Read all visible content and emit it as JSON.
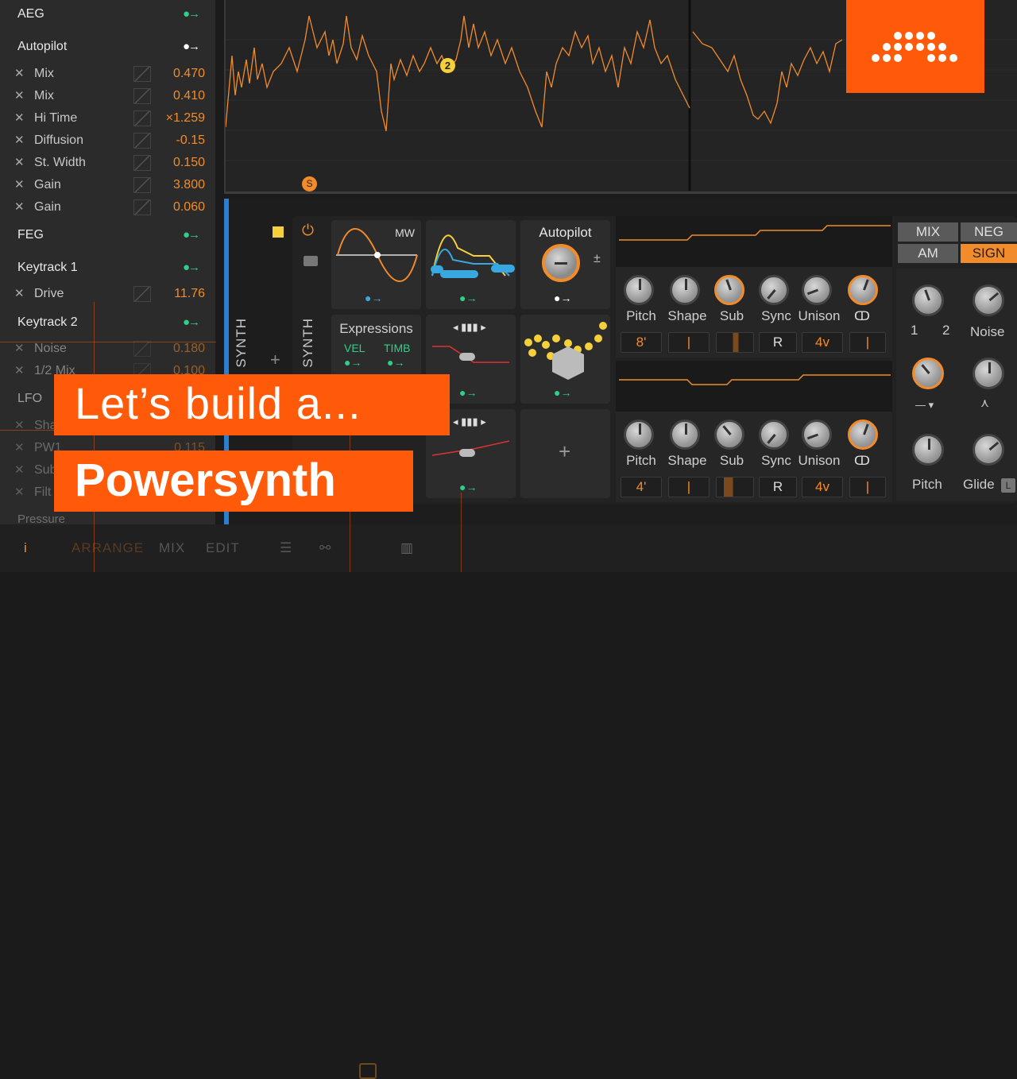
{
  "left_panel": {
    "sections": [
      {
        "label": "AEG"
      },
      {
        "label": "Autopilot"
      },
      {
        "label": "FEG"
      },
      {
        "label": "Keytrack 1"
      },
      {
        "label": "Keytrack 2"
      },
      {
        "label": "LFO"
      },
      {
        "label": "Pressure"
      }
    ],
    "autopilot_params": [
      {
        "name": "Mix",
        "value": "0.470"
      },
      {
        "name": "Mix",
        "value": "0.410"
      },
      {
        "name": "Hi Time",
        "value": "×1.259"
      },
      {
        "name": "Diffusion",
        "value": "-0.15"
      },
      {
        "name": "St. Width",
        "value": "0.150"
      },
      {
        "name": "Gain",
        "value": "3.800"
      },
      {
        "name": "Gain",
        "value": "0.060"
      }
    ],
    "keytrack1_params": [
      {
        "name": "Drive",
        "value": "11.76"
      }
    ],
    "keytrack2_params": [
      {
        "name": "Noise",
        "value": "0.180"
      },
      {
        "name": "1/2 Mix",
        "value": "0.100"
      }
    ],
    "lfo_params": [
      {
        "name": "Sha"
      },
      {
        "name": "PW1",
        "value": "0.115"
      },
      {
        "name": "Sub"
      },
      {
        "name": "Filt"
      }
    ],
    "remove_glyph": "✕",
    "arrow_glyph": "●→"
  },
  "arrangement": {
    "marker_2": "2",
    "marker_s": "S"
  },
  "device": {
    "track_name": "SYNTH",
    "track_name2": "SYNTH",
    "add_glyph": "+",
    "power_icon": "⏻",
    "folder_icon": "▬",
    "mw_label": "MW",
    "autopilot_label": "Autopilot",
    "plus_minus": "±",
    "expressions_label": "Expressions",
    "vel_label": "VEL",
    "timb_label": "TIMB",
    "add_modulator": "+",
    "osc1": {
      "labels": [
        "Pitch",
        "Shape",
        "Sub",
        "Sync",
        "Unison"
      ],
      "octave": "8'",
      "sync_btn": "R",
      "voices": "4v"
    },
    "osc2": {
      "labels": [
        "Pitch",
        "Shape",
        "Sub",
        "Sync",
        "Unison"
      ],
      "octave": "4'",
      "sync_btn": "R",
      "voices": "4v"
    },
    "mix_buttons": [
      "MIX",
      "NEG",
      "AM",
      "SIGN"
    ],
    "mixer_labels": {
      "one": "1",
      "two": "2",
      "noise": "Noise",
      "pitch": "Pitch",
      "glide": "Glide",
      "l": "L",
      "dash": "— ▾"
    }
  },
  "title": {
    "line1": "Let’s build a...",
    "line2": "Powersynth"
  },
  "bottom_bar": {
    "info": "i",
    "arrange": "ARRANGE",
    "mix": "MIX",
    "edit": "EDIT"
  },
  "colors": {
    "accent": "#f28b2a",
    "brand": "#ff5a0a",
    "mod_green": "#2ecf8a",
    "mod_blue": "#3aa8e0",
    "yellow": "#f5d03a"
  }
}
